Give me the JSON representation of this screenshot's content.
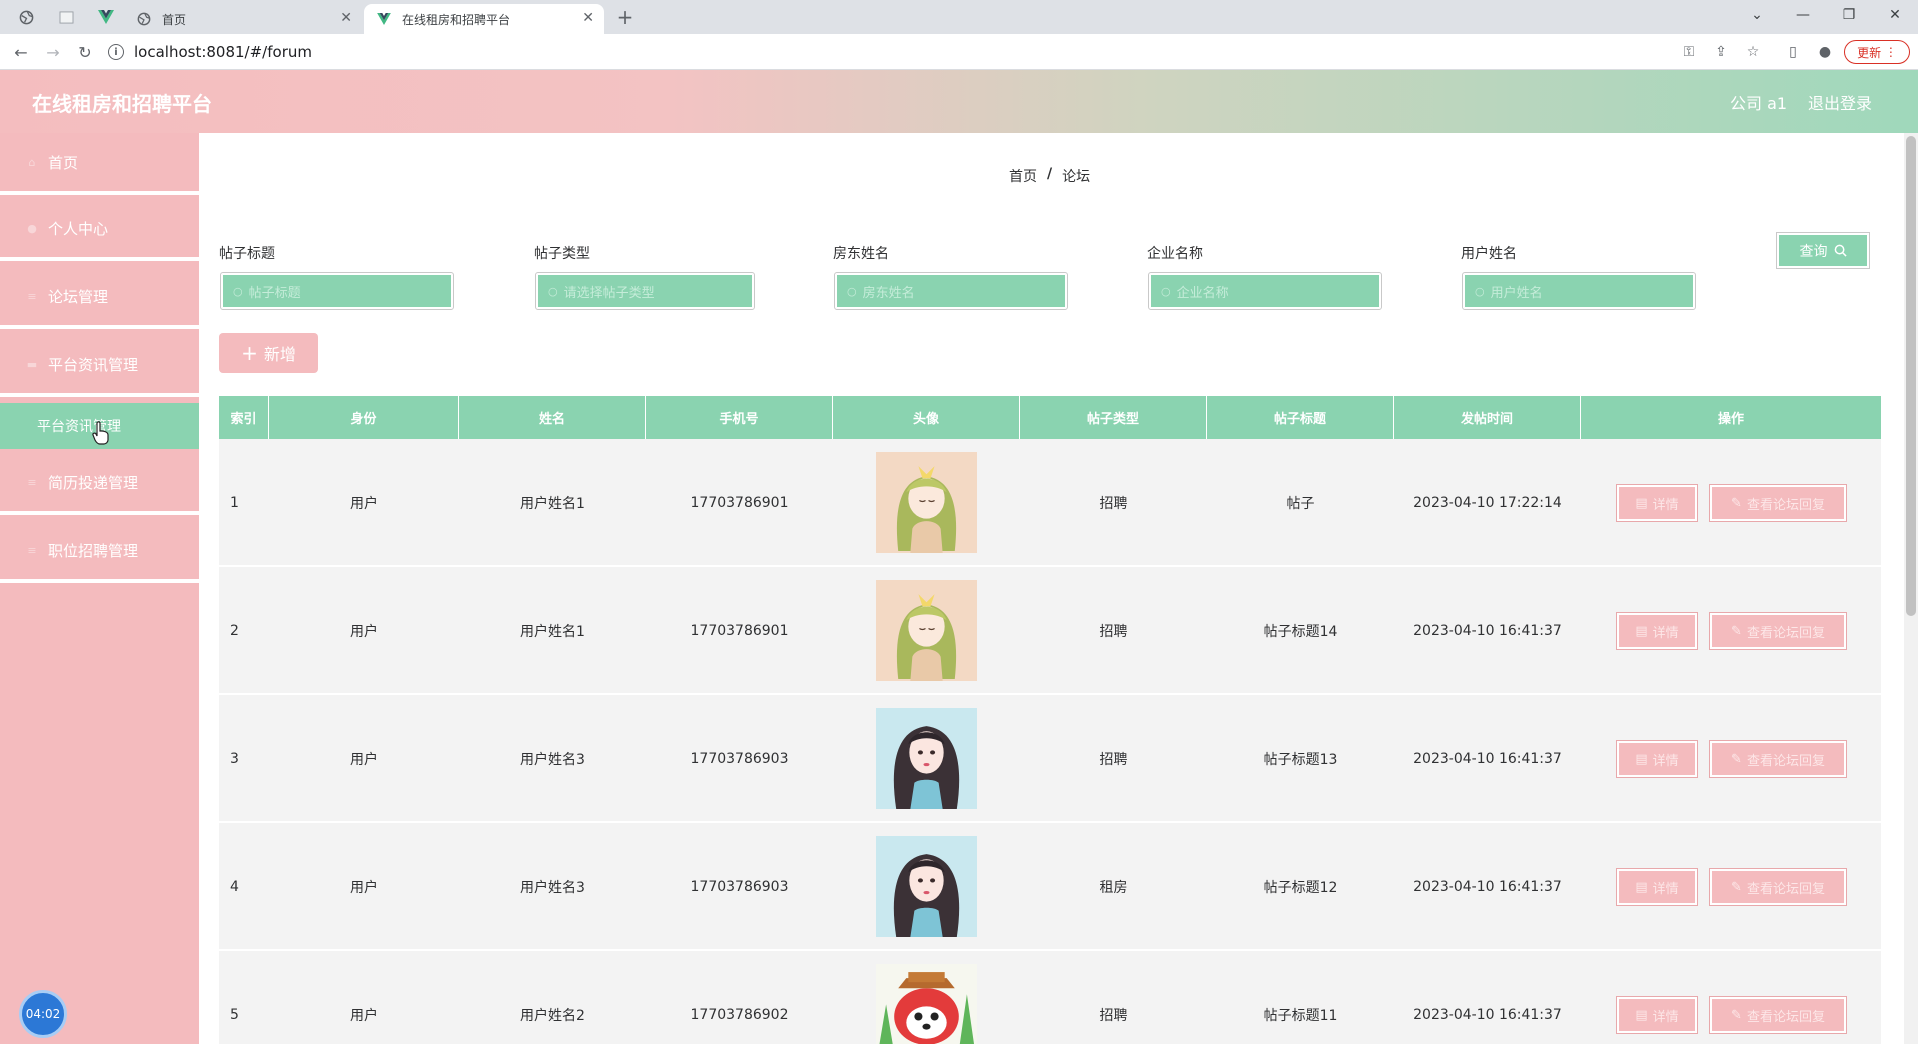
{
  "browser": {
    "tabs": [
      {
        "title": "首页",
        "active": false
      },
      {
        "title": "在线租房和招聘平台",
        "active": true
      }
    ],
    "url": "localhost:8081/#/forum",
    "update_label": "更新"
  },
  "header": {
    "title": "在线租房和招聘平台",
    "user": "公司 a1",
    "logout": "退出登录"
  },
  "sidebar": {
    "items": [
      {
        "label": "首页"
      },
      {
        "label": "个人中心"
      },
      {
        "label": "论坛管理"
      },
      {
        "label": "平台资讯管理"
      },
      {
        "label": "平台资讯管理"
      },
      {
        "label": "简历投递管理"
      },
      {
        "label": "职位招聘管理"
      }
    ],
    "clock": "04:02"
  },
  "breadcrumb": {
    "home": "首页",
    "sep": "/",
    "current": "论坛"
  },
  "filters": [
    {
      "label": "帖子标题",
      "placeholder": "帖子标题"
    },
    {
      "label": "帖子类型",
      "placeholder": "请选择帖子类型"
    },
    {
      "label": "房东姓名",
      "placeholder": "房东姓名"
    },
    {
      "label": "企业名称",
      "placeholder": "企业名称"
    },
    {
      "label": "用户姓名",
      "placeholder": "用户姓名"
    }
  ],
  "search_label": "查询",
  "add_label": "新增",
  "table": {
    "columns": [
      "索引",
      "身份",
      "姓名",
      "手机号",
      "头像",
      "帖子类型",
      "帖子标题",
      "发帖时间",
      "操作"
    ],
    "detail_label": "详情",
    "reply_label": "查看论坛回复",
    "rows": [
      {
        "index": "1",
        "role": "用户",
        "name": "用户姓名1",
        "phone": "17703786901",
        "avatar": "girl-ribbon",
        "type": "招聘",
        "title": "帖子",
        "time": "2023-04-10 17:22:14"
      },
      {
        "index": "2",
        "role": "用户",
        "name": "用户姓名1",
        "phone": "17703786901",
        "avatar": "girl-ribbon",
        "type": "招聘",
        "title": "帖子标题14",
        "time": "2023-04-10 16:41:37"
      },
      {
        "index": "3",
        "role": "用户",
        "name": "用户姓名3",
        "phone": "17703786903",
        "avatar": "girl-dark-hair",
        "type": "招聘",
        "title": "帖子标题13",
        "time": "2023-04-10 16:41:37"
      },
      {
        "index": "4",
        "role": "用户",
        "name": "用户姓名3",
        "phone": "17703786903",
        "avatar": "girl-dark-hair",
        "type": "租房",
        "title": "帖子标题12",
        "time": "2023-04-10 16:41:37"
      },
      {
        "index": "5",
        "role": "用户",
        "name": "用户姓名2",
        "phone": "17703786902",
        "avatar": "cartoon-fox",
        "type": "招聘",
        "title": "帖子标题11",
        "time": "2023-04-10 16:41:37"
      }
    ]
  },
  "colors": {
    "pink": "#f4bbbe",
    "green": "#8ad3b0"
  }
}
